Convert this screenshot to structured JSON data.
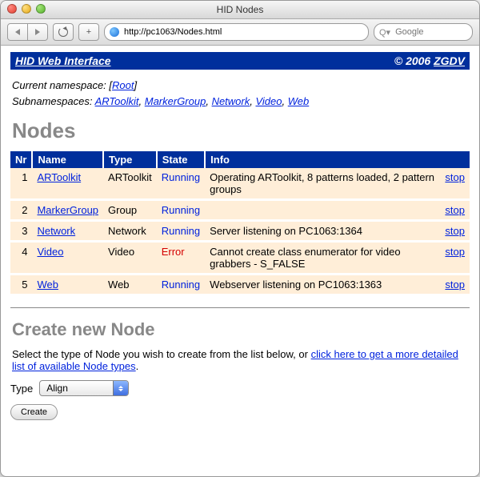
{
  "window": {
    "title": "HID Nodes"
  },
  "browser": {
    "url": "http://pc1063/Nodes.html",
    "search_placeholder": "Google"
  },
  "banner": {
    "left_text": "HID Web Interface",
    "right_text": "© 2006 ZGDV",
    "right_link_text": "ZGDV"
  },
  "namespace": {
    "current_label": "Current namespace: ",
    "current_root": "Root",
    "sub_label": "Subnamespaces: ",
    "items": [
      "ARToolkit",
      "MarkerGroup",
      "Network",
      "Video",
      "Web"
    ]
  },
  "headings": {
    "nodes": "Nodes",
    "create": "Create new Node"
  },
  "table": {
    "headers": {
      "nr": "Nr",
      "name": "Name",
      "type": "Type",
      "state": "State",
      "info": "Info"
    },
    "action_label": "stop",
    "rows": [
      {
        "nr": "1",
        "name": "ARToolkit",
        "type": "ARToolkit",
        "state": "Running",
        "state_class": "running",
        "info": "Operating ARToolkit, 8 patterns loaded, 2 pattern groups"
      },
      {
        "nr": "2",
        "name": "MarkerGroup",
        "type": "Group",
        "state": "Running",
        "state_class": "running",
        "info": ""
      },
      {
        "nr": "3",
        "name": "Network",
        "type": "Network",
        "state": "Running",
        "state_class": "running",
        "info": "Server listening on PC1063:1364"
      },
      {
        "nr": "4",
        "name": "Video",
        "type": "Video",
        "state": "Error",
        "state_class": "error",
        "info": "Cannot create class enumerator for video grabbers - S_FALSE"
      },
      {
        "nr": "5",
        "name": "Web",
        "type": "Web",
        "state": "Running",
        "state_class": "running",
        "info": "Webserver listening on PC1063:1363"
      }
    ]
  },
  "create_section": {
    "instruction_prefix": "Select the type of Node you wish to create from the list below, or ",
    "instruction_link": "click here to get a more detailed list of available Node types",
    "type_label": "Type",
    "selected_type": "Align",
    "create_button": "Create"
  }
}
